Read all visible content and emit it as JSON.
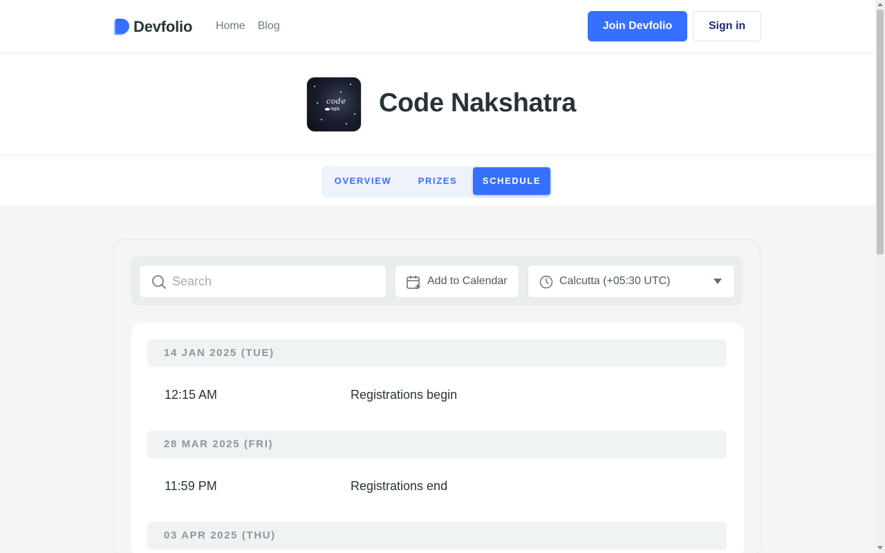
{
  "header": {
    "brand": "Devfolio",
    "nav": [
      "Home",
      "Blog"
    ],
    "join_label": "Join Devfolio",
    "signin_label": "Sign in"
  },
  "hackathon": {
    "title": "Code Nakshatra",
    "logo_text_top": "code",
    "logo_text_bottom": "नक्षत्र"
  },
  "tabs": [
    {
      "label": "OVERVIEW",
      "active": false
    },
    {
      "label": "PRIZES",
      "active": false
    },
    {
      "label": "SCHEDULE",
      "active": true
    }
  ],
  "toolbar": {
    "search_placeholder": "Search",
    "calendar_label": "Add to Calendar",
    "timezone": "Calcutta (+05:30 UTC)"
  },
  "schedule": [
    {
      "date": "14 JAN 2025 (TUE)",
      "events": [
        {
          "time": "12:15 AM",
          "name": "Registrations begin"
        }
      ]
    },
    {
      "date": "28 MAR 2025 (FRI)",
      "events": [
        {
          "time": "11:59 PM",
          "name": "Registrations end"
        }
      ]
    },
    {
      "date": "03 APR 2025 (THU)",
      "events": []
    }
  ],
  "colors": {
    "accent": "#3770ff",
    "text": "#273339",
    "muted": "#8a979c"
  }
}
